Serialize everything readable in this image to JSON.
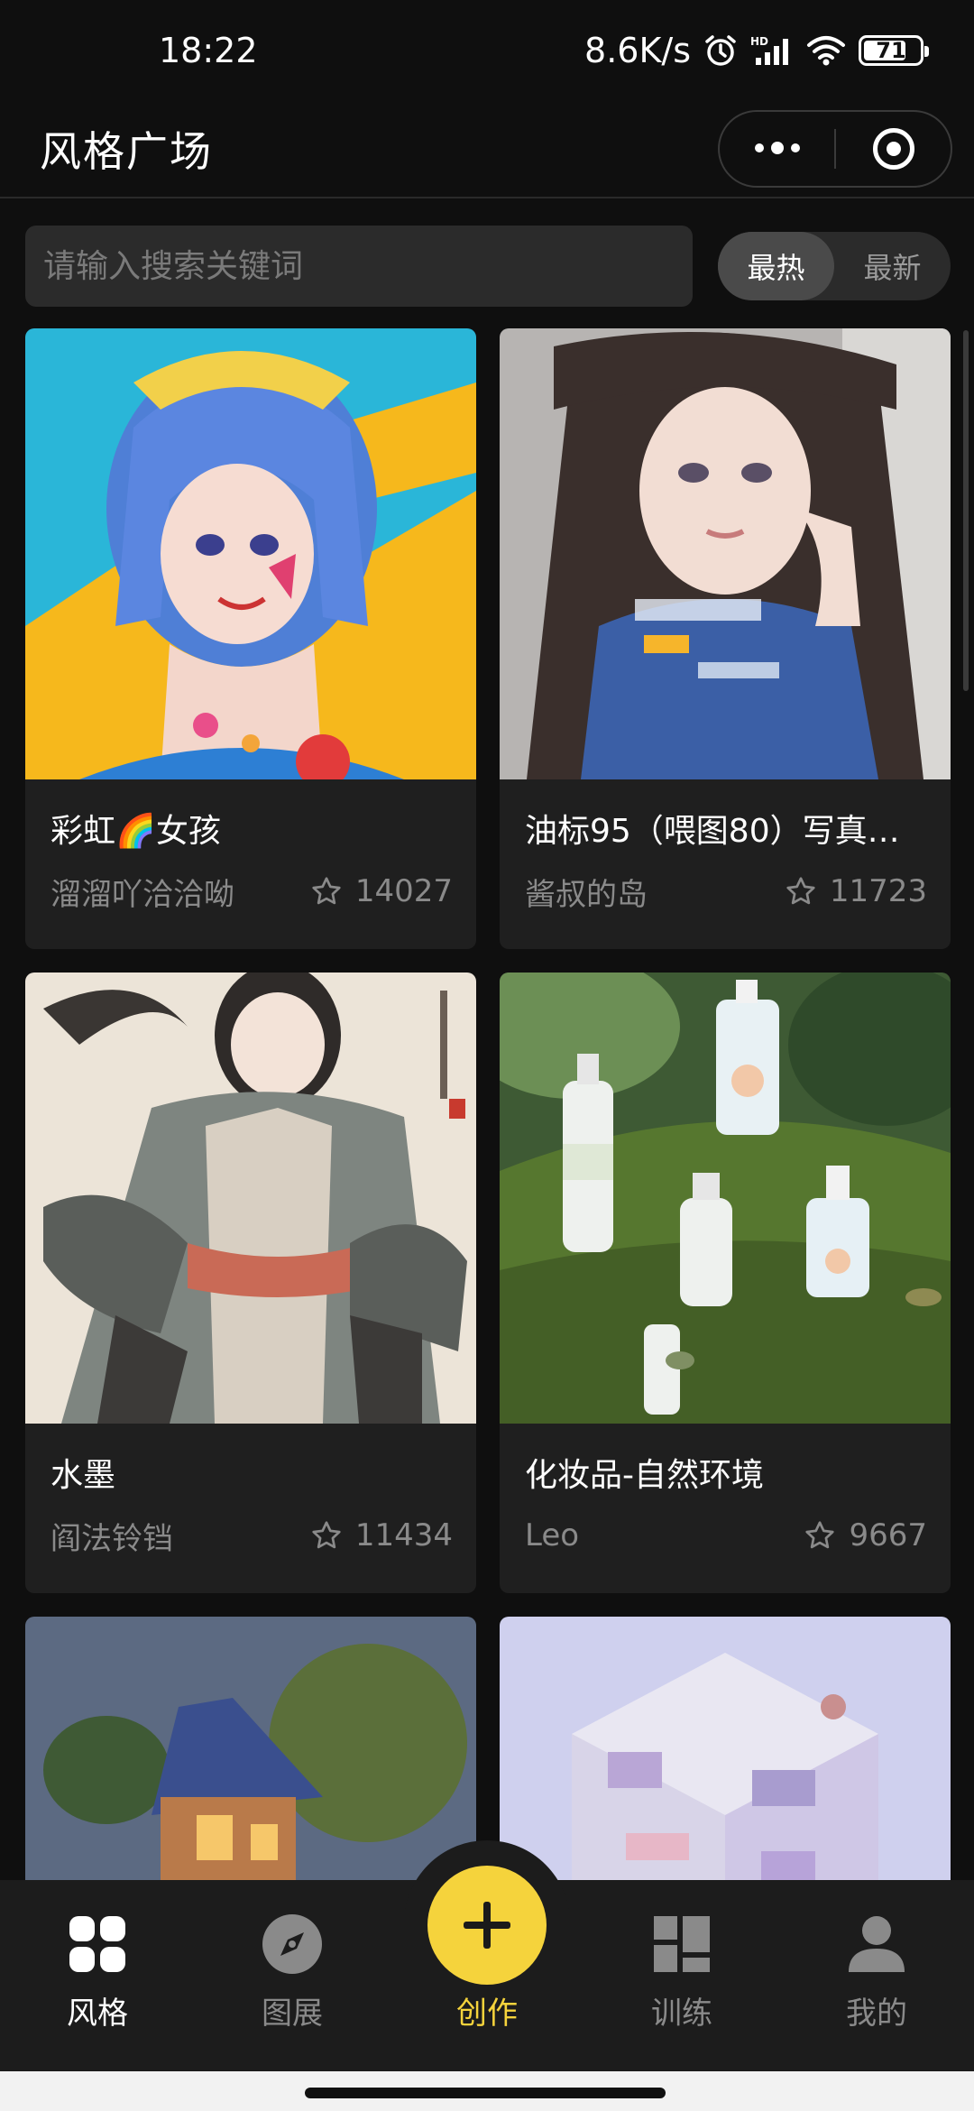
{
  "status_bar": {
    "time": "18:22",
    "net_speed": "8.6K/s",
    "battery": "71",
    "icons": [
      "alarm-icon",
      "hd-signal-icon",
      "wifi-icon",
      "battery-icon"
    ]
  },
  "header": {
    "title": "风格广场"
  },
  "search": {
    "placeholder": "请输入搜索关键词",
    "value": ""
  },
  "sort": {
    "options": [
      "最热",
      "最新"
    ],
    "selected": "最热"
  },
  "cards": [
    {
      "title": "彩虹🌈女孩",
      "author": "溜溜吖洽洽呦",
      "likes": "14027"
    },
    {
      "title": "油标95（喂图80）写真…",
      "author": "酱叔的岛",
      "likes": "11723"
    },
    {
      "title": "水墨",
      "author": "阎法铃铛",
      "likes": "11434"
    },
    {
      "title": "化妆品-自然环境",
      "author": "Leo",
      "likes": "9667"
    },
    {
      "title": "",
      "author": "",
      "likes": ""
    },
    {
      "title": "",
      "author": "",
      "likes": ""
    }
  ],
  "tab_bar": {
    "items": [
      {
        "label": "风格",
        "icon": "grid-icon"
      },
      {
        "label": "图展",
        "icon": "compass-icon"
      },
      {
        "label": "创作",
        "icon": "plus-icon"
      },
      {
        "label": "训练",
        "icon": "dashboard-icon"
      },
      {
        "label": "我的",
        "icon": "user-icon"
      }
    ],
    "active": "风格",
    "accent": "#f5d33c"
  }
}
